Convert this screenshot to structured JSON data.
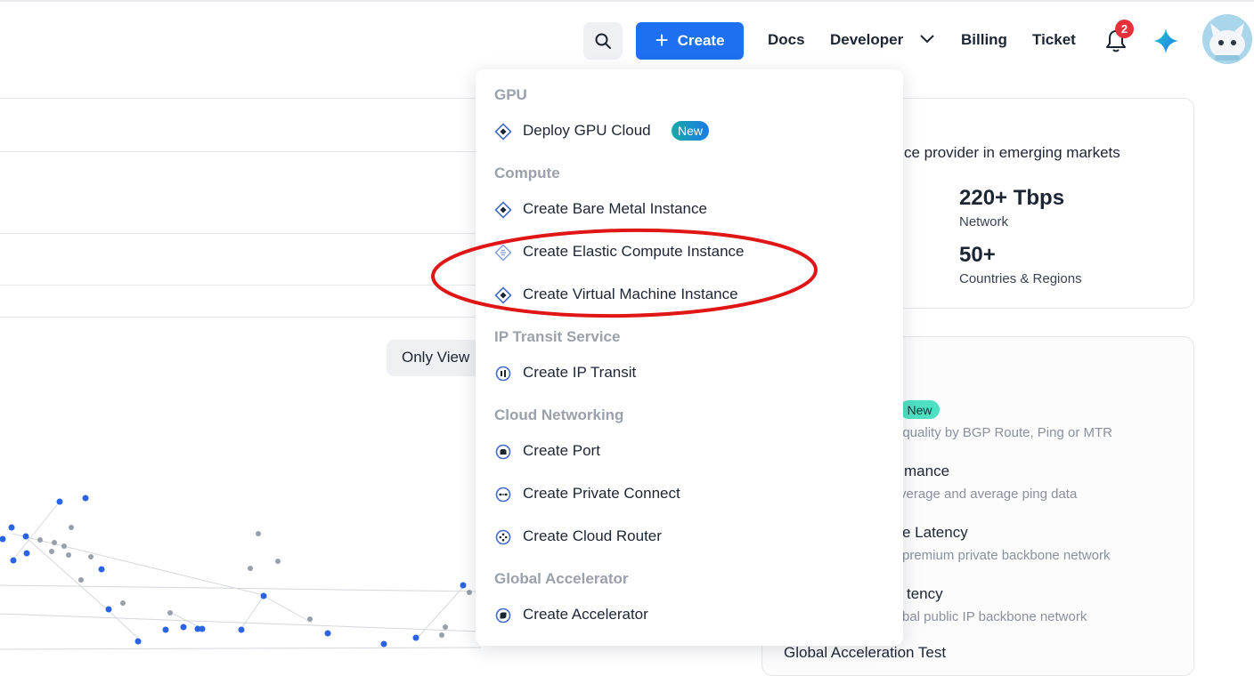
{
  "header": {
    "create_label": "Create",
    "nav": [
      {
        "label": "Docs"
      },
      {
        "label": "Developer"
      },
      {
        "label": "Billing"
      },
      {
        "label": "Ticket"
      }
    ],
    "notification_count": "2",
    "icons": {
      "search": "search-icon",
      "bell": "bell-icon",
      "ai": "sparkle-icon",
      "avatar": "avatar"
    },
    "colors": {
      "primary": "#1f6ff1",
      "badge": "#e5313a",
      "highlight": "#e01515",
      "new_badge": "#4fe0c3"
    }
  },
  "background": {
    "only_view_label": "Only View",
    "stats": {
      "tagline": "rvice provider in emerging markets",
      "items": [
        {
          "value": "220+ Tbps",
          "label": "Network"
        },
        {
          "value": "50+",
          "label": "Countries & Regions"
        }
      ]
    },
    "tools": {
      "new_badge": "New",
      "items": [
        {
          "title": "",
          "desc": "t quality by BGP Route, Ping or MTR"
        },
        {
          "title": "mance",
          "desc": "verage and average ping data"
        },
        {
          "title": "e Latency",
          "desc": "premium private backbone network"
        },
        {
          "title": "tency",
          "desc": "bal public IP backbone network"
        },
        {
          "title": "Global Acceleration Test",
          "desc": ""
        }
      ]
    }
  },
  "create_menu": {
    "sections": [
      {
        "label": "GPU",
        "items": [
          {
            "label": "Deploy GPU Cloud",
            "badge": "New",
            "icon": "diamond-icon"
          }
        ]
      },
      {
        "label": "Compute",
        "items": [
          {
            "label": "Create Bare Metal Instance",
            "icon": "diamond-icon"
          },
          {
            "label": "Create Elastic Compute Instance",
            "icon": "diamond-stack-icon"
          },
          {
            "label": "Create Virtual Machine Instance",
            "icon": "diamond-icon"
          }
        ]
      },
      {
        "label": "IP Transit Service",
        "items": [
          {
            "label": "Create IP Transit",
            "icon": "transit-icon"
          }
        ]
      },
      {
        "label": "Cloud Networking",
        "items": [
          {
            "label": "Create Port",
            "icon": "port-icon"
          },
          {
            "label": "Create Private Connect",
            "icon": "connect-icon"
          },
          {
            "label": "Create Cloud Router",
            "icon": "router-icon"
          }
        ]
      },
      {
        "label": "Global Accelerator",
        "items": [
          {
            "label": "Create Accelerator",
            "icon": "accelerator-icon"
          }
        ]
      }
    ]
  }
}
